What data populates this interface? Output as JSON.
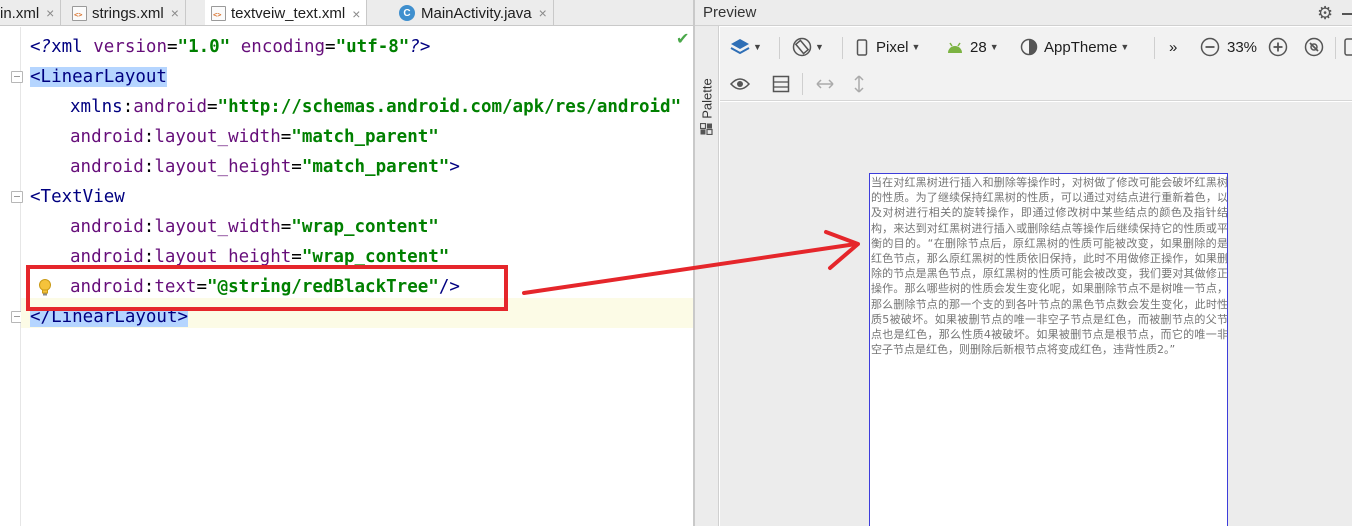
{
  "tabs": [
    {
      "label": "in.xml",
      "type": "xml"
    },
    {
      "label": "strings.xml",
      "type": "xml"
    },
    {
      "label": "textveiw_text.xml",
      "type": "xml",
      "active": true
    },
    {
      "label": "MainActivity.java",
      "type": "java"
    }
  ],
  "tab_close_glyph": "×",
  "editor": {
    "line1": {
      "open": "<?",
      "name": "xml",
      "attr1": " version",
      "eq1": "=",
      "val1": "\"1.0\"",
      "attr2": " encoding",
      "eq2": "=",
      "val2": "\"utf-8\"",
      "close": "?>"
    },
    "line2": {
      "text": "<LinearLayout"
    },
    "line3": {
      "ns": "xmlns",
      "colon": ":",
      "attr": "android",
      "eq": "=",
      "val": "\"http://schemas.android.com/apk/res/android\""
    },
    "line4": {
      "ns": "android",
      "colon": ":",
      "attr": "layout_width",
      "eq": "=",
      "val": "\"match_parent\""
    },
    "line5": {
      "ns": "android",
      "colon": ":",
      "attr": "layout_height",
      "eq": "=",
      "val": "\"match_parent\"",
      "end": ">"
    },
    "line6": {
      "text": "<TextView"
    },
    "line7": {
      "ns": "android",
      "colon": ":",
      "attr": "layout_width",
      "eq": "=",
      "val": "\"wrap_content\""
    },
    "line8": {
      "ns": "android",
      "colon": ":",
      "attr": "layout_height",
      "eq": "=",
      "val": "\"wrap_content\""
    },
    "line9": {
      "ns": "android",
      "colon": ":",
      "attr": "text",
      "eq": "=",
      "val": "\"@string/redBlackTree\"",
      "end": "/>"
    },
    "line10": {
      "text": "</LinearLayout>"
    }
  },
  "preview": {
    "title": "Preview",
    "palette_label": "Palette",
    "device": "Pixel",
    "api": "28",
    "theme": "AppTheme",
    "more": "»",
    "zoom": "33%",
    "device_text": "当在对红黑树进行插入和删除等操作时，对树做了修改可能会破坏红黑树的性质。为了继续保持红黑树的性质，可以通过对结点进行重新着色，以及对树进行相关的旋转操作，即通过修改树中某些结点的颜色及指针结构，来达到对红黑树进行插入或删除结点等操作后继续保持它的性质或平衡的目的。“在删除节点后，原红黑树的性质可能被改变，如果删除的是红色节点，那么原红黑树的性质依旧保持，此时不用做修正操作，如果删除的节点是黑色节点，原红黑树的性质可能会被改变，我们要对其做修正操作。那么哪些树的性质会发生变化呢，如果删除节点不是树唯一节点，那么删除节点的那一个支的到各叶节点的黑色节点数会发生变化，此时性质5被破坏。如果被删节点的唯一非空子节点是红色，而被删节点的父节点也是红色，那么性质4被破坏。如果被删节点是根节点，而它的唯一非空子节点是红色，则删除后新根节点将变成红色，违背性质2。”"
  },
  "annotation": {
    "highlight_color": "#e5262b"
  },
  "colors": {
    "tag": "#000080",
    "attribute": "#660e7a",
    "string": "#008000",
    "selection": "#b5d5ff",
    "device_border": "#3d3ddb"
  }
}
